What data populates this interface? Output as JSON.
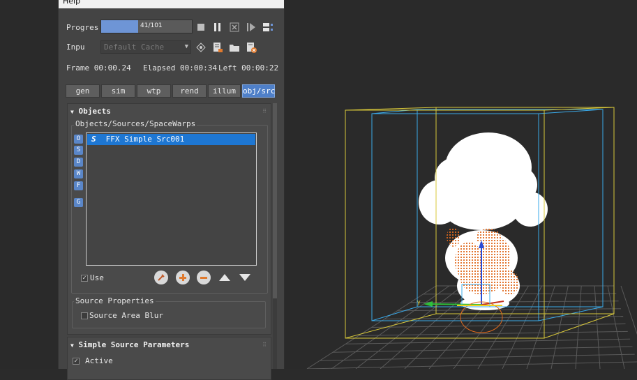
{
  "menu": {
    "help": "Help"
  },
  "progress_row": {
    "label": "Progres",
    "text": "41/101",
    "fraction": 0.4059
  },
  "input_row": {
    "label": "Inpu",
    "select_value": "Default Cache"
  },
  "frame_row": {
    "frame": "Frame 00:00.24",
    "elapsed": "Elapsed 00:00:34",
    "left": "Left 00:00:22"
  },
  "tabs": [
    {
      "label": "gen",
      "active": false
    },
    {
      "label": "sim",
      "active": false
    },
    {
      "label": "wtp",
      "active": false
    },
    {
      "label": "rend",
      "active": false
    },
    {
      "label": "illum",
      "active": false
    },
    {
      "label": "obj/src",
      "active": true
    }
  ],
  "objects_rollout": {
    "title": "Objects",
    "group_label": "Objects/Sources/SpaceWarps",
    "side_buttons": [
      "O",
      "S",
      "D",
      "W",
      "F",
      "G"
    ],
    "list_items": [
      {
        "badge": "S",
        "label": "FFX Simple Src001"
      }
    ],
    "use_label": "Use",
    "use_checked": true
  },
  "source_properties": {
    "group_label": "Source Properties",
    "area_blur_label": "Source Area Blur",
    "area_blur_checked": false
  },
  "simple_source_rollout": {
    "title": "Simple Source Parameters",
    "active_label": "Active",
    "active_checked": true
  },
  "icons": {
    "stop": "stop-icon",
    "pause": "pause-icon",
    "cancel": "cancel-icon",
    "play": "play-icon",
    "options": "options-icon",
    "pick": "pick-cache-icon",
    "cache_info": "cache-info-icon",
    "folder": "folder-icon",
    "delete_cache": "delete-cache-icon",
    "pick_object": "pick-object-icon",
    "add": "add-icon",
    "remove": "remove-icon",
    "up": "arrow-up-icon",
    "down": "arrow-down-icon"
  },
  "colors": {
    "accent": "#4f80c9",
    "selected_row": "#1e77d3",
    "progress_fill": "#6e95d6",
    "gizmo_yellow": "#d8c83a",
    "gizmo_blue": "#3aa9e8",
    "particles_orange": "#e06a1e"
  }
}
